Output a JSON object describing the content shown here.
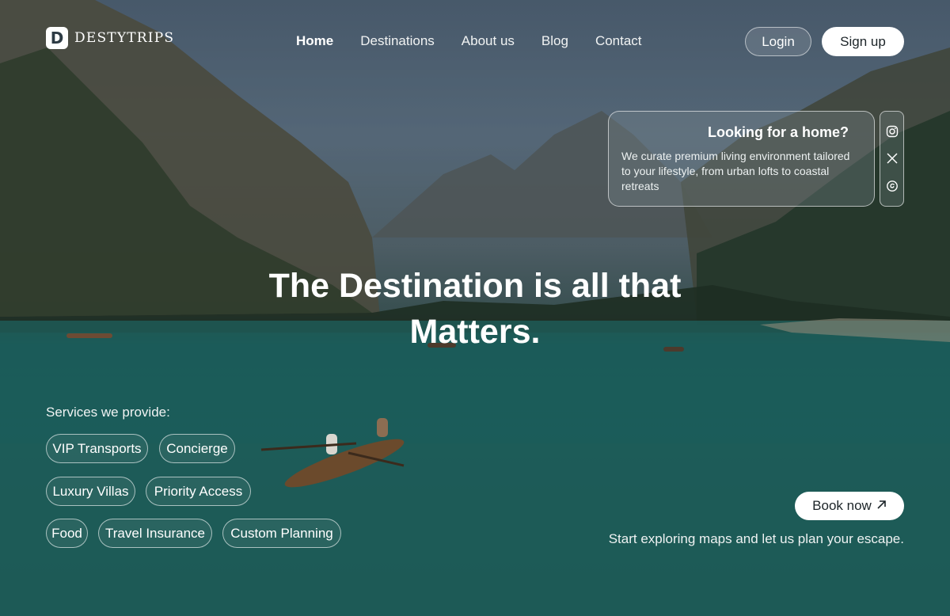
{
  "brand": {
    "logo_letter": "D",
    "name": "DESTYTRIPS"
  },
  "nav": {
    "items": [
      {
        "label": "Home",
        "active": true
      },
      {
        "label": "Destinations",
        "active": false
      },
      {
        "label": "About us",
        "active": false
      },
      {
        "label": "Blog",
        "active": false
      },
      {
        "label": "Contact",
        "active": false
      }
    ]
  },
  "auth": {
    "login_label": "Login",
    "signup_label": "Sign up"
  },
  "card": {
    "title": "Looking for a home?",
    "text": "We curate premium living environment tailored to your lifestyle, from urban lofts to coastal retreats"
  },
  "social": {
    "icons": [
      "instagram-icon",
      "x-icon",
      "threads-icon"
    ]
  },
  "hero": {
    "headline_line1": "The Destination is all that",
    "headline_line2": "Matters."
  },
  "services": {
    "label": "Services we provide:",
    "chips": [
      "VIP Transports",
      "Concierge",
      "Luxury Villas",
      "Priority Access",
      "Food",
      "Travel Insurance",
      "Custom Planning"
    ]
  },
  "cta": {
    "book_label": "Book now",
    "tagline": "Start exploring maps and let us plan your escape."
  },
  "colors": {
    "accent": "#ffffff",
    "lake": "#1f6865",
    "overlay": "#1b2a2c"
  }
}
